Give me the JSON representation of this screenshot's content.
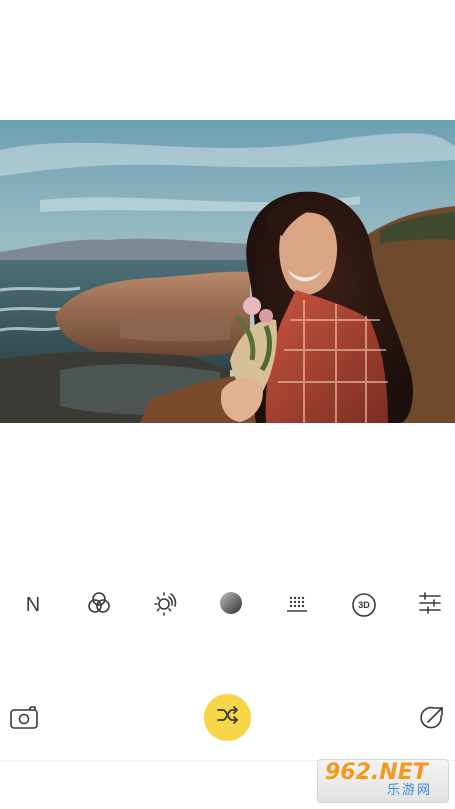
{
  "editor": {
    "filter_tools": [
      {
        "id": "normal",
        "label": "N",
        "icon": "letter-n-icon"
      },
      {
        "id": "color-mix",
        "icon": "overlapping-circles-icon"
      },
      {
        "id": "exposure",
        "icon": "sun-dial-icon"
      },
      {
        "id": "tone",
        "icon": "gradient-circle-icon"
      },
      {
        "id": "grain",
        "icon": "dotted-grid-icon"
      },
      {
        "id": "3d",
        "label": "3D",
        "icon": "3d-circle-icon"
      },
      {
        "id": "adjust",
        "icon": "sliders-icon"
      }
    ],
    "bottom_bar": {
      "camera_icon": "camera-icon",
      "shuffle_icon": "shuffle-icon",
      "share_icon": "export-arrow-icon"
    },
    "colors": {
      "accent": "#f7d548",
      "icon": "#3a3a3a"
    }
  },
  "watermark": {
    "top": "962.NET",
    "bottom": "乐游网"
  }
}
